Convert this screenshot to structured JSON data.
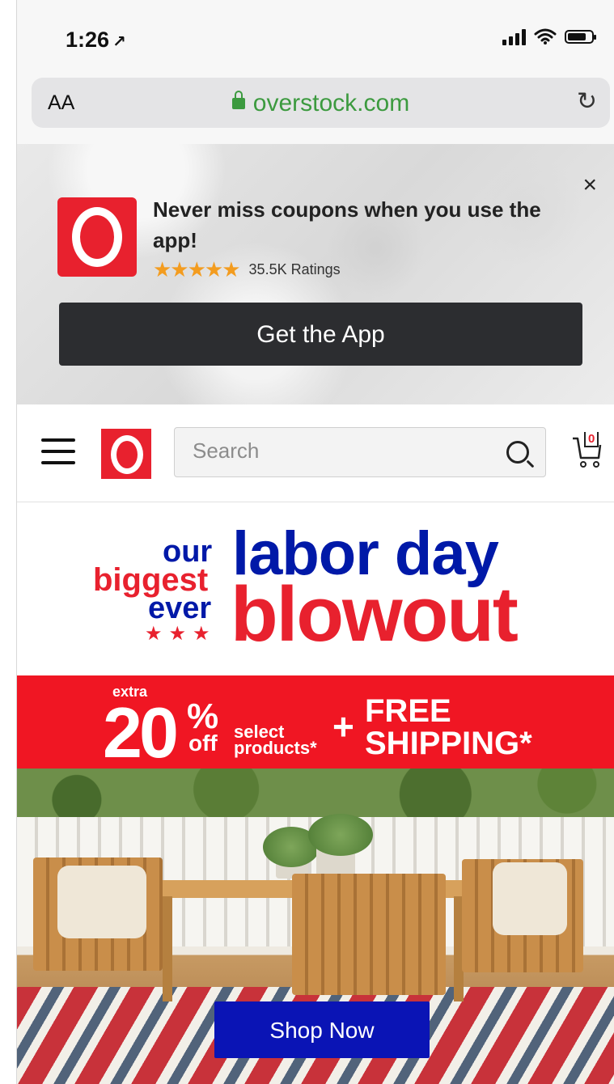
{
  "status_bar": {
    "time": "1:26",
    "location_arrow": "↗"
  },
  "browser": {
    "text_size_label": "AA",
    "url": "overstock.com",
    "reload_glyph": "↻"
  },
  "app_banner": {
    "close_glyph": "×",
    "title": "Never miss coupons when you use the app!",
    "stars": "★★★★★",
    "ratings": "35.5K Ratings",
    "cta": "Get the App"
  },
  "header": {
    "search_placeholder": "Search",
    "cart_count": "0"
  },
  "headline": {
    "our": "our",
    "biggest": "biggest",
    "ever": "ever",
    "stars": "★★★",
    "labor_day": "labor day",
    "blowout": "blowout"
  },
  "deal": {
    "extra": "extra",
    "amount": "20",
    "percent": "%",
    "off": "off",
    "select_line1": "select",
    "select_line2": "products*",
    "plus": "+",
    "free_line1": "FREE",
    "free_line2": "SHIPPING*"
  },
  "hero": {
    "cta": "Shop Now"
  },
  "colors": {
    "brand_red": "#e8212e",
    "brand_blue": "#0019a8",
    "url_green": "#3c9a3f",
    "cta_dark": "#2c2d30",
    "shop_now_blue": "#0a14b5"
  }
}
